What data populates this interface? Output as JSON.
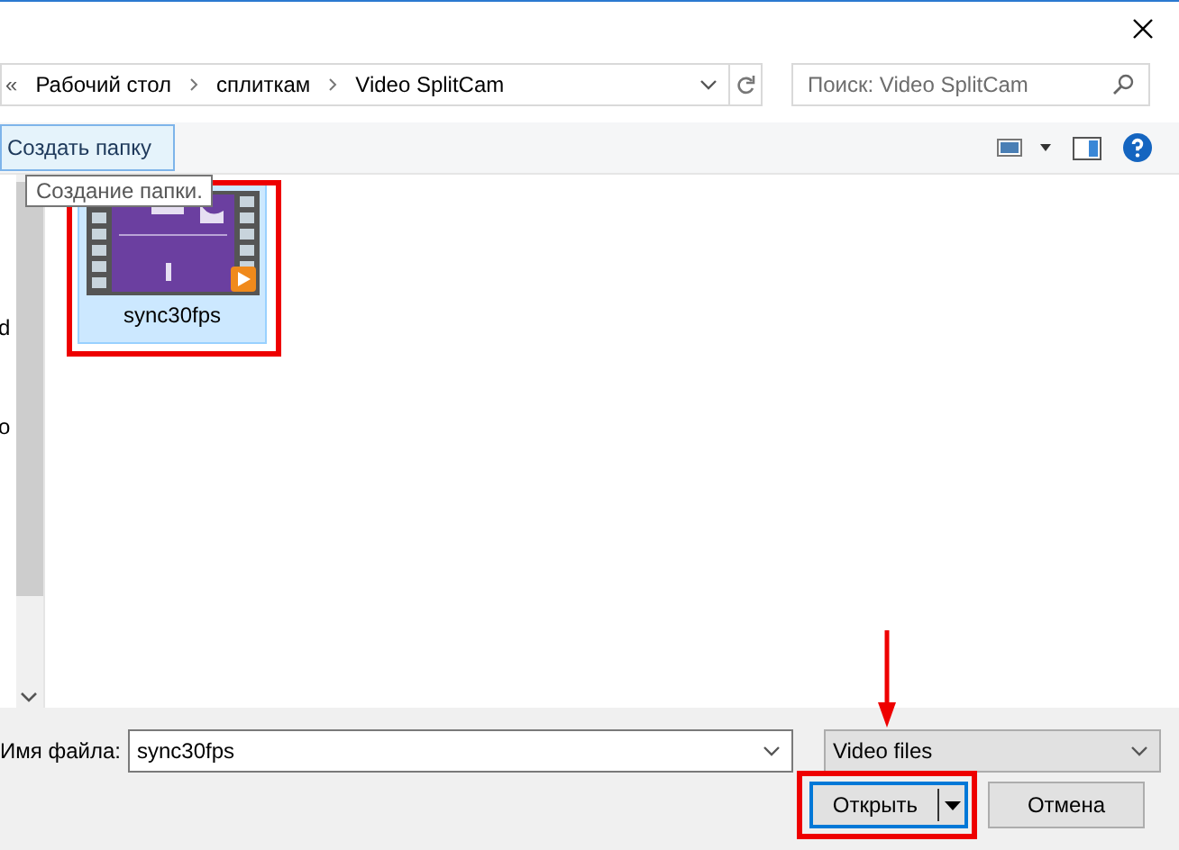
{
  "address_bar": {
    "overflow": "«",
    "path": [
      "Рабочий стол",
      "сплиткам",
      "Video SplitCam"
    ]
  },
  "search": {
    "placeholder": "Поиск: Video SplitCam"
  },
  "toolbar": {
    "new_folder": "Создать папку"
  },
  "tooltip": "Создание папки.",
  "navigation_pane": {
    "items": [
      "d",
      "o"
    ]
  },
  "files": [
    {
      "name": "sync30fps",
      "kind": "video",
      "selected": true
    }
  ],
  "file_name": {
    "label": "Имя файла:",
    "value": "sync30fps"
  },
  "file_type": {
    "value": "Video files"
  },
  "buttons": {
    "open": "Открыть",
    "cancel": "Отмена"
  }
}
